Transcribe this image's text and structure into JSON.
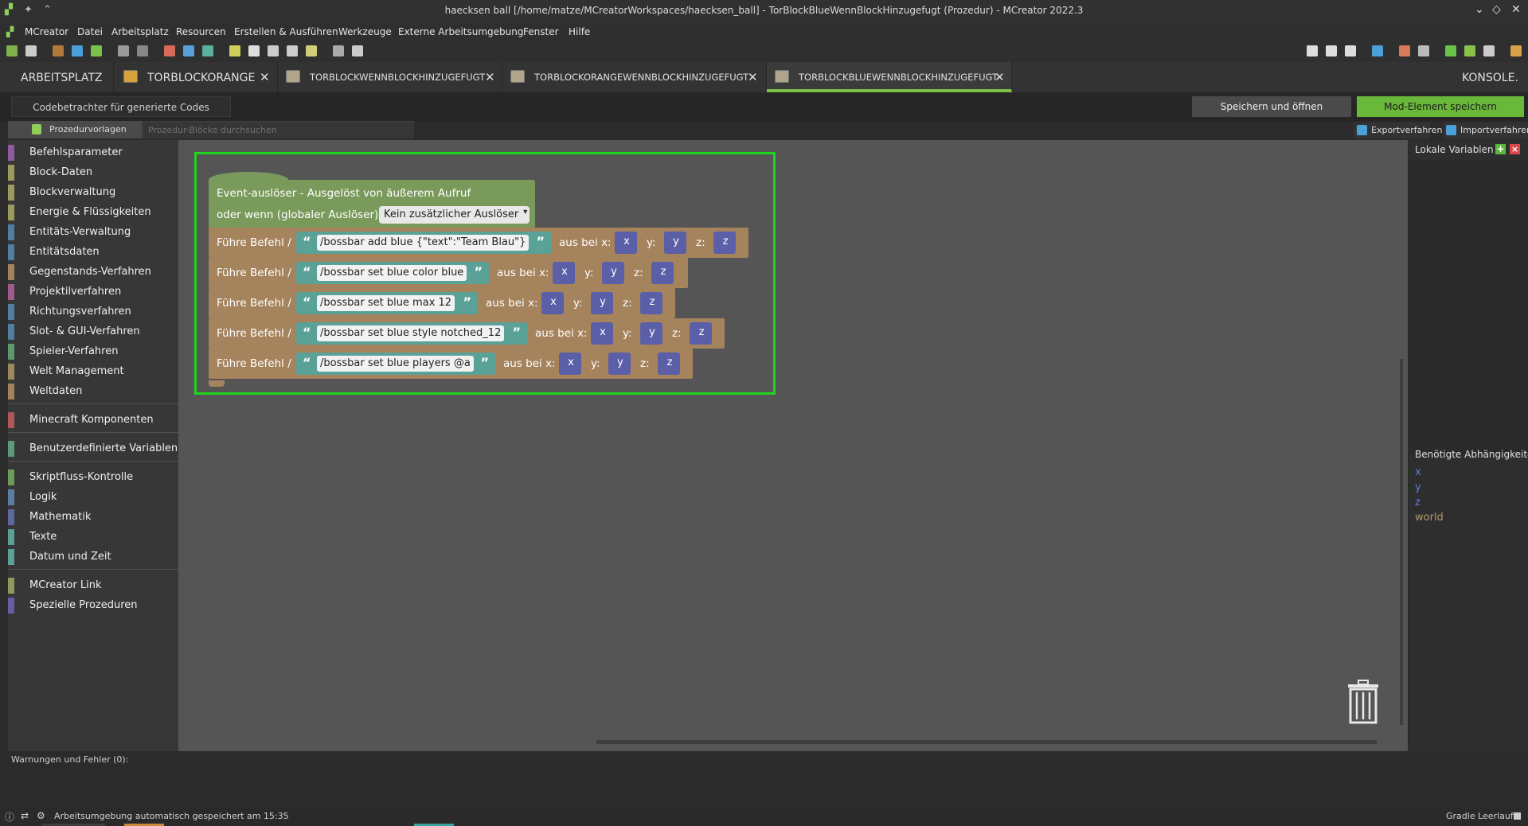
{
  "window": {
    "title": "haecksen ball [/home/matze/MCreatorWorkspaces/haecksen_ball] - TorBlockBlueWennBlockHinzugefugt (Prozedur) - MCreator 2022.3"
  },
  "menu": {
    "items": [
      "MCreator",
      "Datei",
      "Arbeitsplatz",
      "Resourcen",
      "Erstellen & Ausführen",
      "Werkzeuge",
      "Externe Arbeitsumgebung",
      "Fenster",
      "Hilfe"
    ]
  },
  "tabs": {
    "workspace": "ARBEITSPLATZ",
    "items": [
      "TORBLOCKORANGE",
      "TORBLOCKWENNBLOCKHINZUGEFUGT",
      "TORBLOCKORANGEWENNBLOCKHINZUGEFUGT",
      "TORBLOCKBLUEWENNBLOCKHINZUGEFUGT"
    ],
    "console": "KONSOLE."
  },
  "subbar": {
    "code_viewer": "Codebetrachter für generierte Codes",
    "save_open": "Speichern und öffnen",
    "save_mod": "Mod-Element speichern"
  },
  "left_tabs": {
    "templates": "Prozedurvorlagen",
    "search_placeholder": "Prozedur-Blöcke durchsuchen"
  },
  "right_tabs": {
    "export": "Exportverfahren",
    "import": "Importverfahren"
  },
  "palette": {
    "group1": [
      "Befehlsparameter",
      "Block-Daten",
      "Blockverwaltung",
      "Energie & Flüssigkeiten",
      "Entitäts-Verwaltung",
      "Entitätsdaten",
      "Gegenstands-Verfahren",
      "Projektilverfahren",
      "Richtungsverfahren",
      "Slot- & GUI-Verfahren",
      "Spieler-Verfahren",
      "Welt Management",
      "Weltdaten"
    ],
    "group2": [
      "Minecraft Komponenten"
    ],
    "group3": [
      "Benutzerdefinierte Variablen"
    ],
    "group4": [
      "Skriptfluss-Kontrolle",
      "Logik",
      "Mathematik",
      "Texte",
      "Datum und Zeit"
    ],
    "group5": [
      "MCreator Link",
      "Spezielle Prozeduren"
    ],
    "colors": {
      "group1": [
        "#8e5c9e",
        "#9c9a5c",
        "#9c9a5c",
        "#9c9a5c",
        "#4f7ea0",
        "#4f7ea0",
        "#a5835d",
        "#a05c8e",
        "#4f7ea0",
        "#4f7ea0",
        "#5c9a6e",
        "#9c8a5c",
        "#a5835d"
      ],
      "group2": [
        "#b05858"
      ],
      "group3": [
        "#5c9a7a"
      ],
      "group4": [
        "#6e9a5c",
        "#5c7ea0",
        "#5c6aa0",
        "#5aa197",
        "#5aa197"
      ],
      "group5": [
        "#8e9a5c",
        "#6a5ca0"
      ]
    }
  },
  "blocks": {
    "event_line1": "Event-auslöser - Ausgelöst von äußerem Aufruf",
    "event_line2": "oder wenn (globaler Auslöser):",
    "trigger_dropdown": "Kein zusätzlicher Auslöser",
    "cmd_label": "Führe Befehl /",
    "aus_bei": "aus bei x:",
    "y_label": "y:",
    "z_label": "z:",
    "var_x": "x",
    "var_y": "y",
    "var_z": "z",
    "commands": [
      "/bossbar add blue {\"text\":\"Team Blau\"}",
      "/bossbar set blue color blue",
      "/bossbar set blue max 12",
      "/bossbar set blue style notched_12",
      "/bossbar set blue players @a"
    ]
  },
  "right_panel": {
    "local_vars": "Lokale Variablen",
    "deps_title": "Benötigte Abhängigkeiten",
    "deps": [
      "x",
      "y",
      "z",
      "world"
    ],
    "dep_colors": [
      "#5b7fd6",
      "#5b7fd6",
      "#5b7fd6",
      "#b09a6a"
    ]
  },
  "warnings": "Warnungen und Fehler (0):",
  "status": {
    "left": "Arbeitsumgebung automatisch gespeichert am 15:35",
    "right": "Gradle Leerlauf"
  }
}
